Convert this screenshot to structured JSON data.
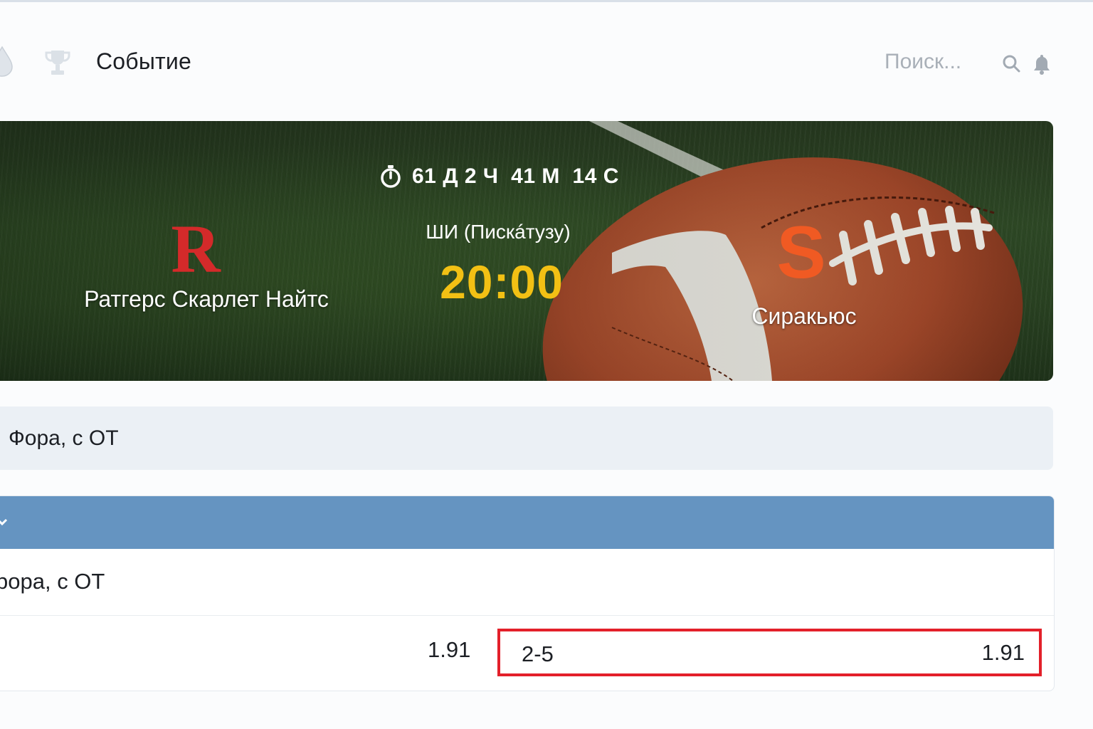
{
  "header": {
    "title": "Событие",
    "search_placeholder": "Поиск...",
    "icons": [
      "drop-icon",
      "trophy-icon",
      "search-icon",
      "bell-icon"
    ]
  },
  "event": {
    "countdown": "61 Д 2 Ч  41 М  14 С",
    "venue": "ШИ (Пискáтузу)",
    "kickoff_time": "20:00",
    "home_team": {
      "name": "Ратгерс Скарлет Найтс",
      "logo_letter": "R",
      "color": "#d42a2a"
    },
    "away_team": {
      "name": "Сиракьюс",
      "logo_letter": "S",
      "color": "#f05a23"
    },
    "kickoff_color": "#f2c014"
  },
  "market_tab": {
    "label": "Фора, с ОТ"
  },
  "market_panel": {
    "header_color": "#6594c1",
    "subtitle": "рора, с ОТ",
    "left_price": "1.91",
    "selected_line": "2-5",
    "selected_price": "1.91",
    "highlight_color": "#e3202a"
  }
}
